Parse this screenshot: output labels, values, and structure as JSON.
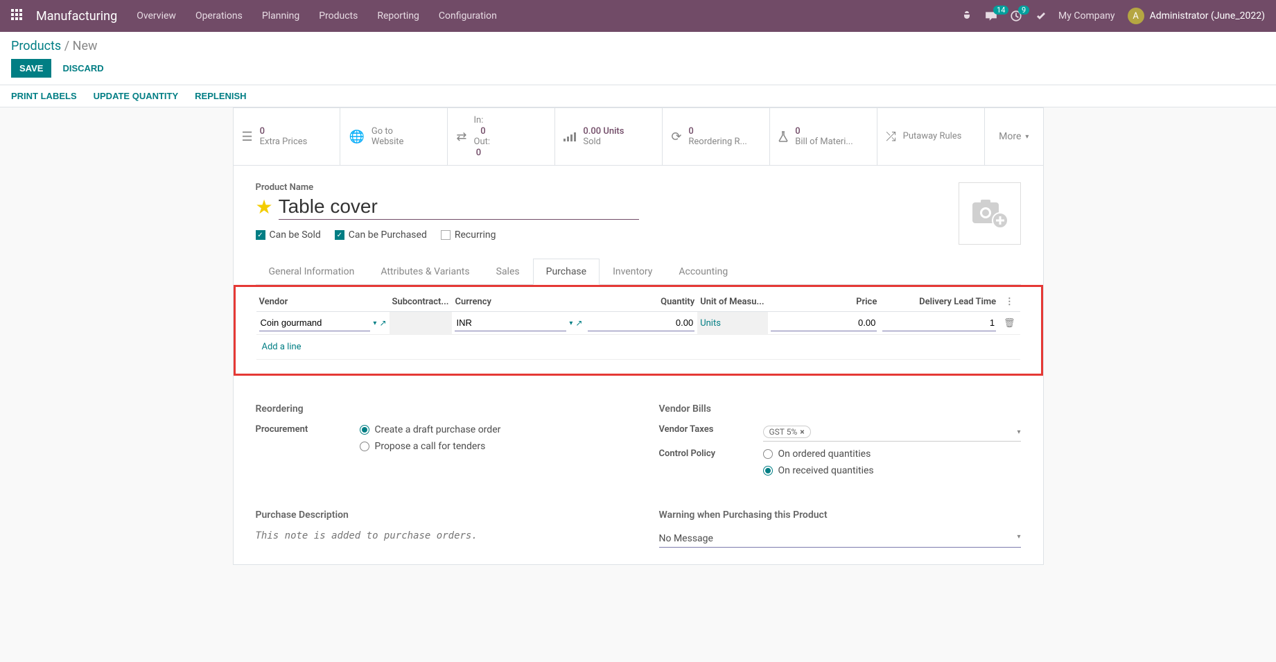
{
  "nav": {
    "app": "Manufacturing",
    "items": [
      "Overview",
      "Operations",
      "Planning",
      "Products",
      "Reporting",
      "Configuration"
    ],
    "msg_badge": "14",
    "activity_badge": "9",
    "company": "My Company",
    "user": "Administrator (June_2022)",
    "avatar_letter": "A"
  },
  "breadcrumb": {
    "root": "Products",
    "current": "New"
  },
  "buttons": {
    "save": "SAVE",
    "discard": "DISCARD"
  },
  "actions": {
    "print": "PRINT LABELS",
    "update": "UPDATE QUANTITY",
    "replenish": "REPLENISH"
  },
  "stats": {
    "extra_prices": {
      "v": "0",
      "l": "Extra Prices"
    },
    "website": {
      "v": "Go to",
      "l": "Website"
    },
    "inout": {
      "in_l": "In:",
      "in_v": "0",
      "out_l": "Out:",
      "out_v": "0"
    },
    "sold": {
      "v": "0.00 Units",
      "l": "Sold"
    },
    "reorder": {
      "v": "0",
      "l": "Reordering R..."
    },
    "bom": {
      "v": "0",
      "l": "Bill of Materi..."
    },
    "putaway": {
      "l": "Putaway Rules"
    },
    "more": "More"
  },
  "form": {
    "product_name_label": "Product Name",
    "product_name": "Table cover",
    "can_sold": "Can be Sold",
    "can_purchased": "Can be Purchased",
    "recurring": "Recurring"
  },
  "tabs": [
    "General Information",
    "Attributes & Variants",
    "Sales",
    "Purchase",
    "Inventory",
    "Accounting"
  ],
  "vendor_table": {
    "headers": {
      "vendor": "Vendor",
      "sub": "Subcontract...",
      "currency": "Currency",
      "qty": "Quantity",
      "uom": "Unit of Measu...",
      "price": "Price",
      "lead": "Delivery Lead Time"
    },
    "row": {
      "vendor": "Coin gourmand",
      "sub": "",
      "currency": "INR",
      "qty": "0.00",
      "uom": "Units",
      "price": "0.00",
      "lead": "1"
    },
    "add_line": "Add a line"
  },
  "lower": {
    "reordering_title": "Reordering",
    "procurement_label": "Procurement",
    "proc_opt1": "Create a draft purchase order",
    "proc_opt2": "Propose a call for tenders",
    "vendor_bills_title": "Vendor Bills",
    "vendor_taxes_label": "Vendor Taxes",
    "tax_tag": "GST 5%",
    "control_policy_label": "Control Policy",
    "cp_opt1": "On ordered quantities",
    "cp_opt2": "On received quantities",
    "purchase_desc_title": "Purchase Description",
    "purchase_desc_ph": "This note is added to purchase orders.",
    "warning_title": "Warning when Purchasing this Product",
    "warning_value": "No Message"
  }
}
